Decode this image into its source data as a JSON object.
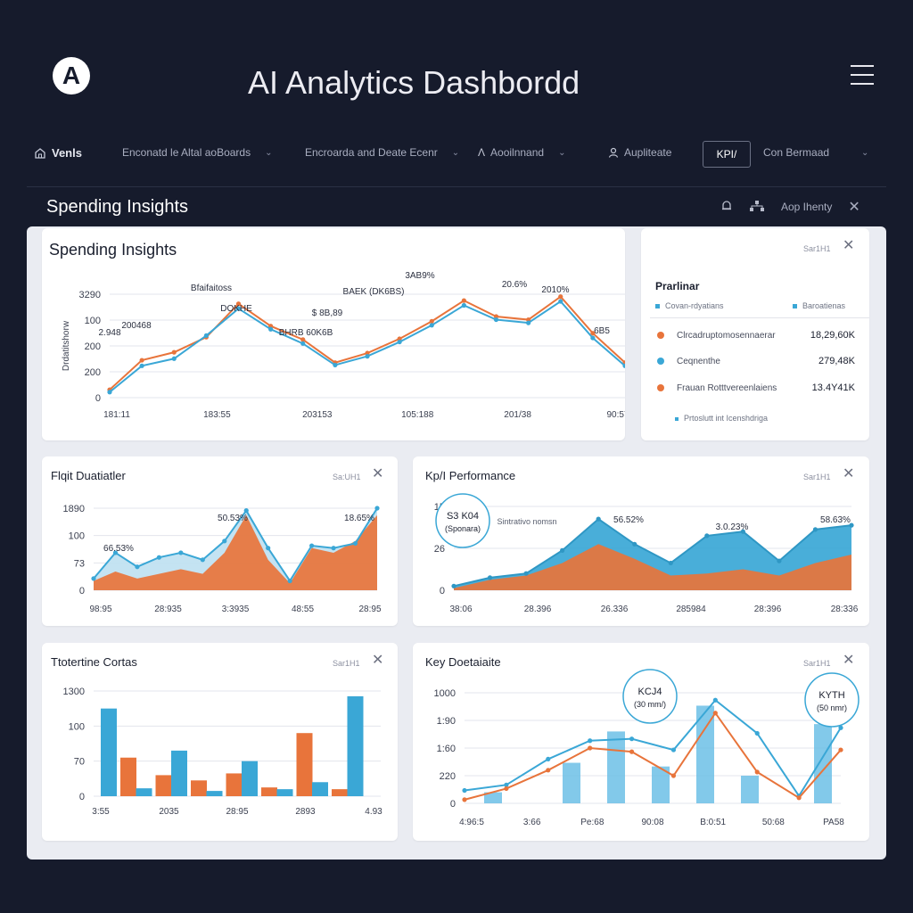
{
  "app": {
    "logo": "A",
    "title": "AI Analytics Dashbordd",
    "menu_icon": "hamburger-icon"
  },
  "nav": {
    "items": [
      {
        "label": "Venls",
        "icon": "home-icon"
      },
      {
        "label": "Enconatd le Altal aoBoards",
        "icon": "chevron-down-icon"
      },
      {
        "label": "Encroarda and Deate Ecenr",
        "icon": "chevron-down-icon"
      },
      {
        "label": "Aooilnnand",
        "icon": "user-icon"
      },
      {
        "label": "Aupliteate",
        "icon": "person-icon"
      },
      {
        "label": "KPI/",
        "icon": ""
      },
      {
        "label": "Con Bermaad",
        "icon": "chevron-down-icon"
      }
    ]
  },
  "section": {
    "title": "Spending Insights",
    "action_label": "Aop Ihenty",
    "icons": [
      "bell-icon",
      "network-icon",
      "close-icon"
    ]
  },
  "cards": {
    "spending": {
      "title": "Spending Insights"
    },
    "legend": {
      "meta": "Sar1H1",
      "title": "Prarlinar",
      "sub_left": "Covan-rdyatians",
      "sub_right": "Baroatienas",
      "rows": [
        {
          "label": "Clrcadruptomosennaerar",
          "value": "18,29,60K",
          "color": "#e8743b"
        },
        {
          "label": "Ceqnenthe",
          "value": "279,48K",
          "color": "#3aa7d6"
        },
        {
          "label": "Frauan Rotttvereenlaiens",
          "value": "13.4Y41K",
          "color": "#e8743b"
        }
      ],
      "footer": "Prtoslutt int Icenshdriga"
    },
    "flight": {
      "title": "Flqit Duatiatler",
      "meta": "Sa:UH1"
    },
    "kpi": {
      "title": "Kp/I Performance",
      "meta": "Sar1H1",
      "callout": "S3 K04",
      "callout_sub": "(Sponara)",
      "callout_note": "Sintrativo nomsn"
    },
    "tiratline": {
      "title": "Ttotertine Cortas",
      "meta": "Sar1H1"
    },
    "key": {
      "title": "Key Doetaiaite",
      "meta": "Sar1H1",
      "callout_a": "KCJ4",
      "callout_a_sub": "(30 mm/)",
      "callout_b": "KYTH",
      "callout_b_sub": "(50 nmr)"
    }
  },
  "chart_data": [
    {
      "id": "spending",
      "type": "line",
      "ylabel": "Drdatitshorw",
      "yticks": [
        "0",
        "200",
        "200",
        "100",
        "3290"
      ],
      "xticks": [
        "181:11",
        "183:55",
        "203153",
        "105:188",
        "201/38",
        "90:57"
      ],
      "x": [
        0,
        1,
        2,
        3,
        4,
        5,
        6,
        7,
        8,
        9,
        10,
        11,
        12,
        13,
        14,
        15,
        16
      ],
      "series": [
        {
          "color": "#e8743b",
          "values": [
            10,
            47,
            57,
            76,
            118,
            90,
            73,
            44,
            56,
            74,
            96,
            122,
            102,
            98,
            127,
            81,
            44
          ]
        },
        {
          "color": "#3aa7d6",
          "values": [
            7,
            40,
            49,
            78,
            112,
            86,
            68,
            41,
            52,
            70,
            91,
            116,
            98,
            94,
            121,
            75,
            40
          ]
        }
      ],
      "data_labels": [
        "Bfaifaitoss",
        "DOKHE",
        "BHRB 60K6B",
        "$ 8B,89",
        "BAEK (DK6BS)",
        "3AB9%",
        "20.6%",
        "2010%",
        "2.948",
        "200468",
        "6B5"
      ]
    },
    {
      "id": "flight",
      "type": "area",
      "yticks": [
        "0",
        "73",
        "100",
        "1890"
      ],
      "xticks": [
        "98:95",
        "28:935",
        "3:3935",
        "48:55",
        "28:95"
      ],
      "series": [
        {
          "color": "#e8743b",
          "values": [
            8,
            16,
            10,
            14,
            18,
            14,
            32,
            64,
            26,
            6,
            36,
            32,
            42,
            64
          ]
        },
        {
          "color": "#3aa7d6",
          "values": [
            10,
            32,
            20,
            28,
            32,
            26,
            42,
            68,
            36,
            8,
            38,
            36,
            40,
            70
          ]
        }
      ],
      "data_labels": [
        "66.53%",
        "50.53%",
        "18.65%"
      ]
    },
    {
      "id": "kpi",
      "type": "area",
      "yticks": [
        "0",
        "26",
        "15"
      ],
      "xticks": [
        "38:06",
        "28.396",
        "26.336",
        "285984",
        "28:396",
        "28:336"
      ],
      "series": [
        {
          "color": "#3aa7d6",
          "values": [
            4,
            12,
            16,
            38,
            68,
            44,
            26,
            52,
            56,
            28,
            58,
            62
          ]
        },
        {
          "color": "#e8743b",
          "values": [
            2,
            10,
            14,
            26,
            44,
            30,
            14,
            16,
            20,
            14,
            26,
            34
          ]
        }
      ],
      "data_labels": [
        "56.52%",
        "3.0.23%",
        "58.63%"
      ]
    },
    {
      "id": "tiratline",
      "type": "bar",
      "yticks": [
        "0",
        "70",
        "100",
        "1300"
      ],
      "xticks": [
        "3:55",
        "2035",
        "28:95",
        "2893",
        "4.93"
      ],
      "series": [
        {
          "color": "#3aa7d6",
          "values": [
            100,
            9,
            52,
            6,
            40,
            8,
            16,
            114
          ]
        },
        {
          "color": "#e8743b",
          "values": [
            44,
            24,
            18,
            26,
            10,
            72,
            8
          ]
        }
      ]
    },
    {
      "id": "key",
      "type": "bar",
      "yticks": [
        "0",
        "220",
        "1:60",
        "1:90",
        "1000"
      ],
      "xticks": [
        "4:96:5",
        "3:66",
        "Pe:68",
        "90:08",
        "B:0:51",
        "50:68",
        "PA58"
      ],
      "series": [
        {
          "color": "#6cc0e6",
          "values": [
            12,
            44,
            78,
            40,
            106,
            30,
            86
          ]
        },
        {
          "color": "#3aa7d6",
          "values": [
            14,
            20,
            48,
            68,
            70,
            58,
            112,
            76,
            8,
            82
          ]
        },
        {
          "color": "#e8743b",
          "values": [
            4,
            16,
            36,
            60,
            56,
            30,
            98,
            34,
            6,
            58
          ]
        }
      ]
    }
  ]
}
